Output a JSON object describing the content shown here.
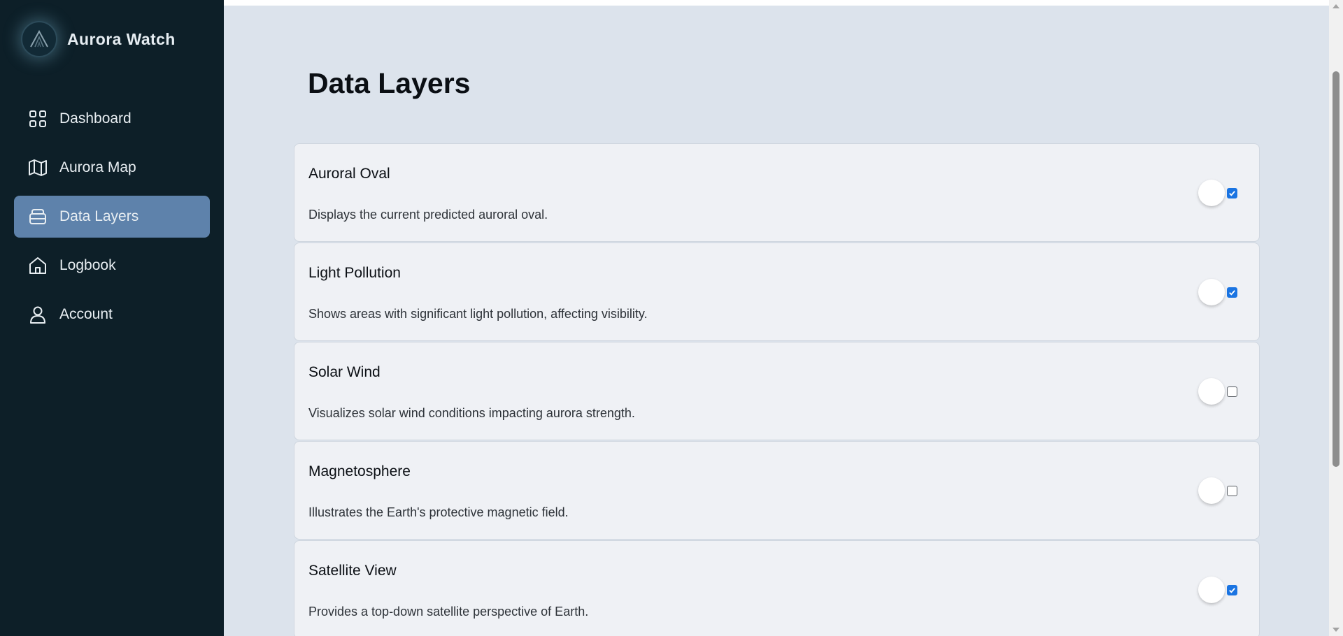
{
  "app": {
    "name": "Aurora Watch"
  },
  "sidebar": {
    "items": [
      {
        "label": "Dashboard",
        "icon": "dashboard-grid-icon",
        "active": false
      },
      {
        "label": "Aurora Map",
        "icon": "map-icon",
        "active": false
      },
      {
        "label": "Data Layers",
        "icon": "layers-icon",
        "active": true
      },
      {
        "label": "Logbook",
        "icon": "home-icon",
        "active": false
      },
      {
        "label": "Account",
        "icon": "user-icon",
        "active": false
      }
    ]
  },
  "main": {
    "title": "Data Layers",
    "layers": [
      {
        "name": "Auroral Oval",
        "description": "Displays the current predicted auroral oval.",
        "enabled": true
      },
      {
        "name": "Light Pollution",
        "description": "Shows areas with significant light pollution, affecting visibility.",
        "enabled": true
      },
      {
        "name": "Solar Wind",
        "description": "Visualizes solar wind conditions impacting aurora strength.",
        "enabled": false
      },
      {
        "name": "Magnetosphere",
        "description": "Illustrates the Earth's protective magnetic field.",
        "enabled": false
      },
      {
        "name": "Satellite View",
        "description": "Provides a top-down satellite perspective of Earth.",
        "enabled": true
      }
    ]
  },
  "colors": {
    "sidebar_bg": "#0d1f28",
    "active_nav": "#5e82ab",
    "main_bg": "#dce3ec",
    "card_bg": "#eff1f5",
    "checkbox_on": "#1a74e2"
  }
}
